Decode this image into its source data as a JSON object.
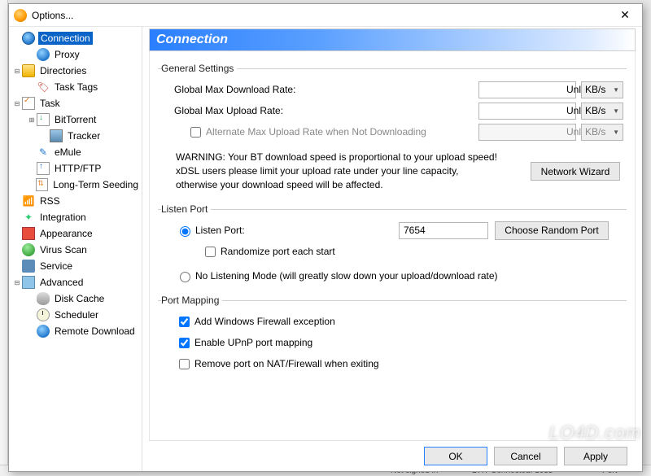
{
  "window": {
    "title": "Options...",
    "close_label": "✕"
  },
  "tree": {
    "items": [
      {
        "label": "Connection",
        "icon": "globe",
        "depth": 0,
        "twisty": "",
        "selected": true
      },
      {
        "label": "Proxy",
        "icon": "globe-sm",
        "depth": 1,
        "twisty": ""
      },
      {
        "label": "Directories",
        "icon": "folder",
        "depth": 0,
        "twisty": "▾"
      },
      {
        "label": "Task Tags",
        "icon": "tag",
        "depth": 1,
        "twisty": ""
      },
      {
        "label": "Task",
        "icon": "task",
        "depth": 0,
        "twisty": "▾"
      },
      {
        "label": "BitTorrent",
        "icon": "bt",
        "depth": 1,
        "twisty": "▸"
      },
      {
        "label": "Tracker",
        "icon": "tracker",
        "depth": 2,
        "twisty": ""
      },
      {
        "label": "eMule",
        "icon": "emule",
        "depth": 1,
        "twisty": ""
      },
      {
        "label": "HTTP/FTP",
        "icon": "http",
        "depth": 1,
        "twisty": ""
      },
      {
        "label": "Long-Term Seeding",
        "icon": "seed",
        "depth": 1,
        "twisty": ""
      },
      {
        "label": "RSS",
        "icon": "rss",
        "depth": 0,
        "twisty": ""
      },
      {
        "label": "Integration",
        "icon": "int",
        "depth": 0,
        "twisty": ""
      },
      {
        "label": "Appearance",
        "icon": "app",
        "depth": 0,
        "twisty": ""
      },
      {
        "label": "Virus Scan",
        "icon": "virus",
        "depth": 0,
        "twisty": ""
      },
      {
        "label": "Service",
        "icon": "service",
        "depth": 0,
        "twisty": ""
      },
      {
        "label": "Advanced",
        "icon": "adv",
        "depth": 0,
        "twisty": "▾"
      },
      {
        "label": "Disk Cache",
        "icon": "disk",
        "depth": 1,
        "twisty": ""
      },
      {
        "label": "Scheduler",
        "icon": "sched",
        "depth": 1,
        "twisty": ""
      },
      {
        "label": "Remote Download",
        "icon": "globe-sm",
        "depth": 1,
        "twisty": ""
      }
    ]
  },
  "panel": {
    "title": "Connection",
    "general": {
      "legend": "General Settings",
      "download_rate_label": "Global Max Download Rate:",
      "download_rate_value": "Unlimited",
      "download_rate_unit": "KB/s",
      "upload_rate_label": "Global Max Upload Rate:",
      "upload_rate_value": "Unlimited",
      "upload_rate_unit": "KB/s",
      "alt_upload_label": "Alternate Max Upload Rate when Not Downloading",
      "alt_upload_value": "Unlimited",
      "alt_upload_unit": "KB/s",
      "warning_line1": "WARNING: Your BT download speed is proportional to your upload speed!",
      "warning_line2": "xDSL users please limit your upload rate under your line capacity,",
      "warning_line3": "otherwise your download speed will be affected.",
      "wizard_button": "Network Wizard"
    },
    "listen": {
      "legend": "Listen Port",
      "listen_port_label": "Listen Port:",
      "listen_port_value": "7654",
      "random_button": "Choose Random Port",
      "randomize_label": "Randomize port each start",
      "nolisten_label": "No Listening Mode (will greatly slow down your upload/download rate)"
    },
    "portmap": {
      "legend": "Port Mapping",
      "firewall_label": "Add Windows Firewall exception",
      "upnp_label": "Enable UPnP port mapping",
      "remove_nat_label": "Remove port on NAT/Firewall when exiting"
    }
  },
  "buttons": {
    "ok": "OK",
    "cancel": "Cancel",
    "apply": "Apply"
  },
  "backdrop": {
    "status1": "Not signed in",
    "status2": "DHT Connected: 1635",
    "status3": "Port"
  },
  "watermark": "LO4D.com"
}
